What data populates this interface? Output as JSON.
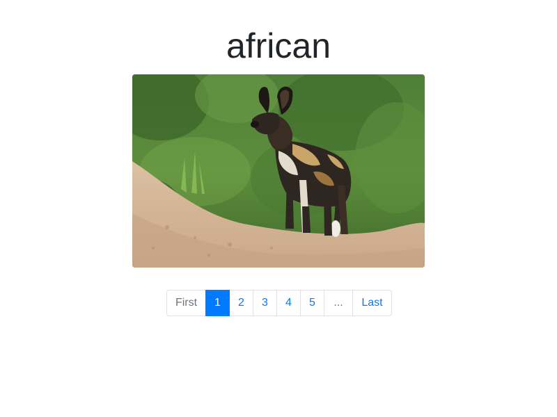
{
  "page": {
    "title": "african"
  },
  "image": {
    "subject": "african wild dog standing on sandy mound",
    "colors": {
      "foliage_dark": "#3f6b2c",
      "foliage_light": "#6fa043",
      "sand": "#d9b896",
      "sand_shadow": "#b8977a",
      "dog_dark": "#2e2620",
      "dog_tan": "#c9a56a"
    }
  },
  "pagination": {
    "first_label": "First",
    "pages": [
      "1",
      "2",
      "3",
      "4",
      "5"
    ],
    "active_page": "1",
    "ellipsis_label": "...",
    "last_label": "Last"
  },
  "colors": {
    "accent": "#007bff",
    "muted": "#6c757d",
    "text": "#212529",
    "border": "#dee2e6"
  }
}
